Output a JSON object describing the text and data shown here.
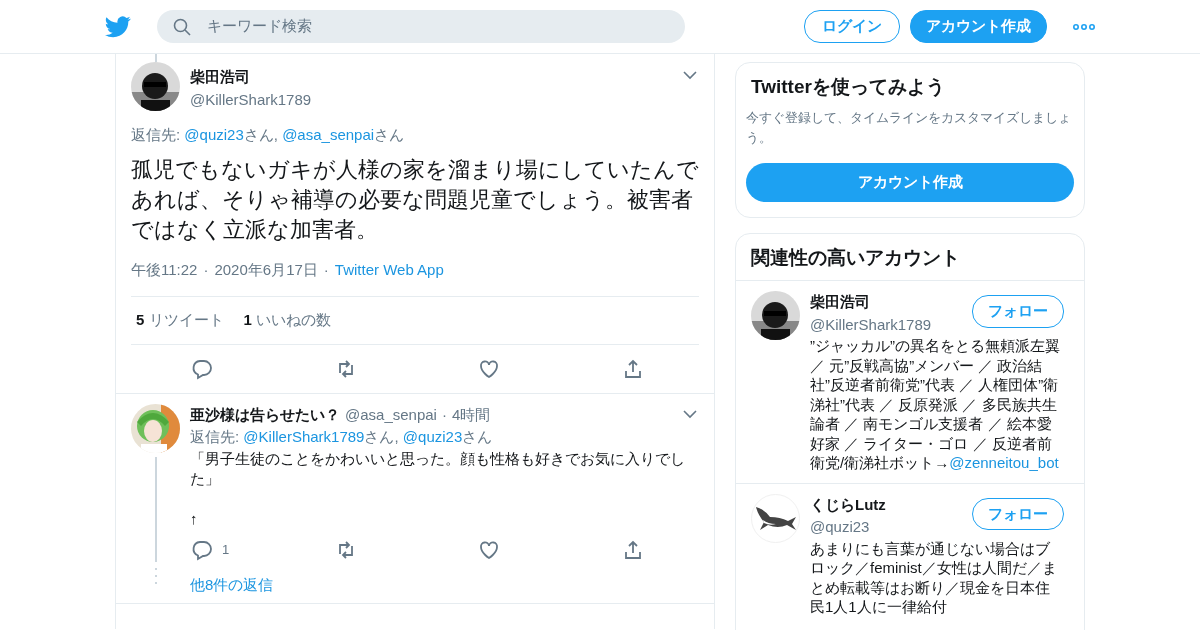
{
  "header": {
    "search": {
      "placeholder": "キーワード検索"
    },
    "login": "ログイン",
    "signup": "アカウント作成"
  },
  "main_tweet": {
    "name": "柴田浩司",
    "handle": "@KillerShark1789",
    "reply_to": [
      {
        "kind": "plain",
        "text": "返信先: "
      },
      {
        "kind": "link",
        "text": "@quzi23"
      },
      {
        "kind": "plain",
        "text": "さん, "
      },
      {
        "kind": "link",
        "text": "@asa_senpai"
      },
      {
        "kind": "plain",
        "text": "さん"
      }
    ],
    "text": "孤児でもないガキが人様の家を溜まり場にしていたんであれば、そりゃ補導の必要な問題児童でしょう。被害者ではなく立派な加害者。",
    "meta": [
      {
        "kind": "plain",
        "text": "午後11:22"
      },
      {
        "kind": "plain",
        "text": "2020年6月17日"
      },
      {
        "kind": "link",
        "text": "Twitter Web App"
      }
    ],
    "separator": "·",
    "stats": [
      {
        "count": "5",
        "label": "リツイート"
      },
      {
        "count": "1",
        "label": "いいねの数"
      }
    ],
    "actions": [
      {
        "kind": "reply"
      },
      {
        "kind": "retweet"
      },
      {
        "kind": "like"
      },
      {
        "kind": "share"
      }
    ]
  },
  "reply_tweet": {
    "name": "亜沙様は告らせたい？",
    "handle": "@asa_senpai",
    "separator": "·",
    "time": "4時間",
    "reply_to": [
      {
        "kind": "plain",
        "text": "返信先: "
      },
      {
        "kind": "link",
        "text": "@KillerShark1789"
      },
      {
        "kind": "plain",
        "text": "さん, "
      },
      {
        "kind": "link",
        "text": "@quzi23"
      },
      {
        "kind": "plain",
        "text": "さん"
      }
    ],
    "text": "「男子生徒のことをかわいいと思った。顔も性格も好きでお気に入りでした」\n\n↑",
    "actions": [
      {
        "kind": "reply",
        "count": "1"
      },
      {
        "kind": "retweet"
      },
      {
        "kind": "like"
      },
      {
        "kind": "share"
      }
    ],
    "more_replies": "他8件の返信"
  },
  "signup_card": {
    "title": "Twitterを使ってみよう",
    "text": "今すぐ登録して、タイムラインをカスタマイズしましょう。",
    "button": "アカウント作成"
  },
  "related": {
    "title": "関連性の高いアカウント",
    "accounts": [
      {
        "name": "柴田浩司",
        "handle": "@KillerShark1789",
        "kind": "person",
        "follow": "フォロー",
        "bio": [
          {
            "kind": "plain",
            "text": "”ジャッカル”の異名をとる無頼派左翼／ 元”反戦高協”メンバー ／ 政治結社”反逆者前衛党”代表 ／ 人権団体”衛涕社”代表 ／ 反原発派 ／ 多民族共生論者 ／ 南モンゴル支援者 ／ 絵本愛好家 ／ ライター・ゴロ ／ 反逆者前衛党/衛涕社ボット→"
          },
          {
            "kind": "link",
            "text": "@zenneitou_bot"
          }
        ]
      },
      {
        "name": "くじらLutz",
        "handle": "@quzi23",
        "kind": "whale",
        "follow": "フォロー",
        "bio": [
          {
            "kind": "plain",
            "text": "あまりにも言葉が通じない場合はブロック／feminist／女性は人間だ／まとめ転載等はお断り／現金を日本住民1人1人に一律給付"
          }
        ]
      }
    ]
  }
}
